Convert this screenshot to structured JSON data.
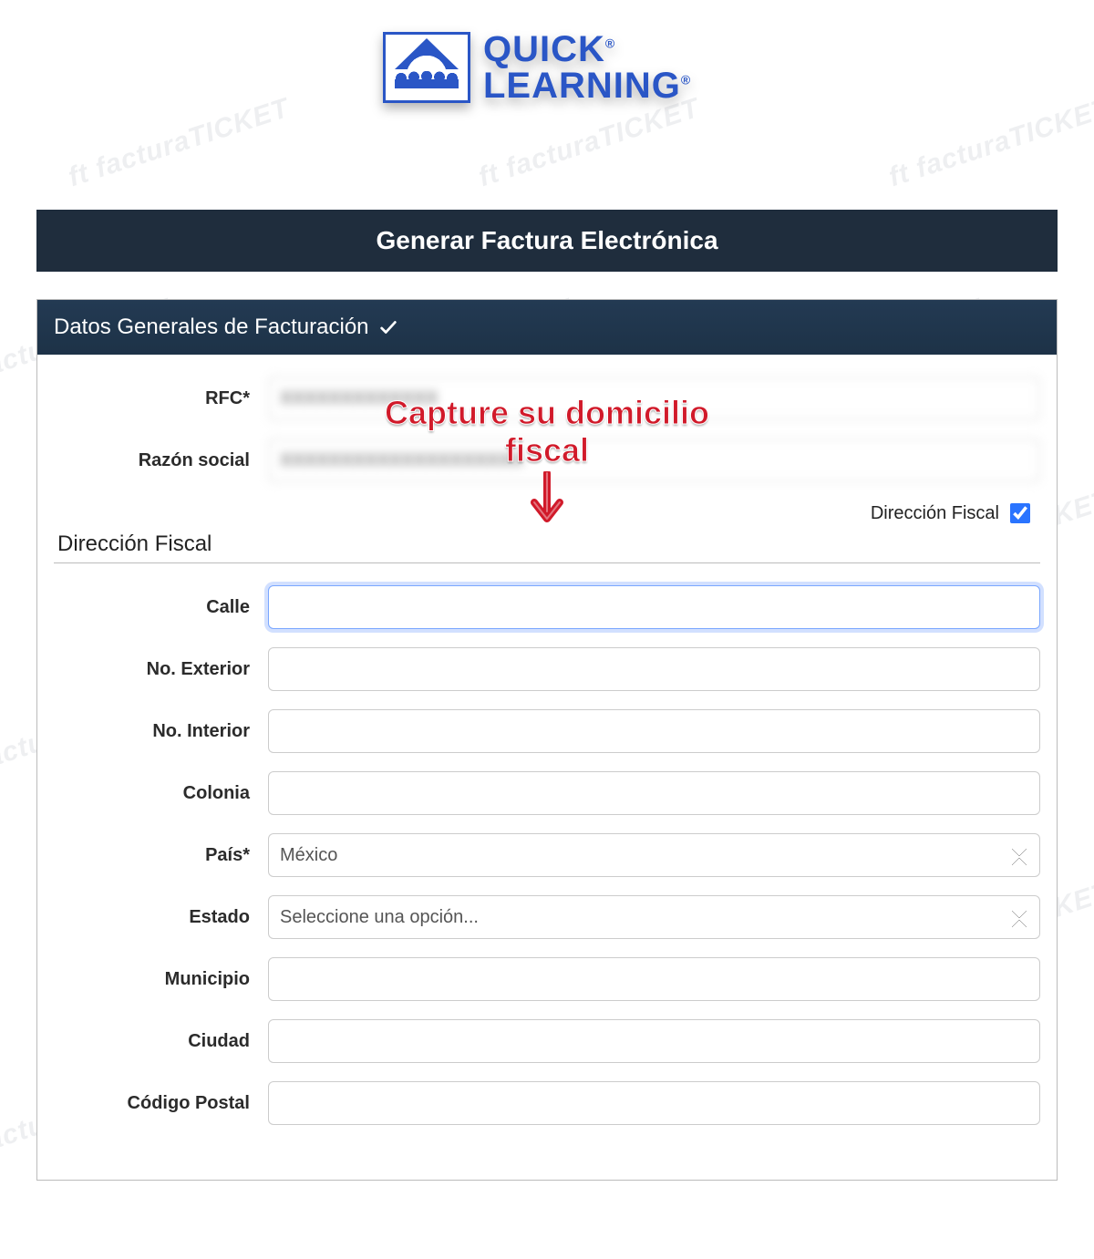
{
  "watermark_text": "ft facturaTICKET",
  "logo": {
    "line1": "QUICK",
    "line2": "LEARNING",
    "registered": "®"
  },
  "title": "Generar Factura Electrónica",
  "panel": {
    "header": "Datos Generales de Facturación"
  },
  "fields": {
    "rfc": {
      "label": "RFC*",
      "value": "XXXXXXXXXXXXX"
    },
    "razon_social": {
      "label": "Razón social",
      "value": "XXXXXXXXXXXXXXXXXXXX"
    },
    "direccion_fiscal_toggle": {
      "label": "Dirección Fiscal",
      "checked": true
    },
    "section_title": "Dirección Fiscal",
    "calle": {
      "label": "Calle",
      "value": ""
    },
    "no_exterior": {
      "label": "No. Exterior",
      "value": ""
    },
    "no_interior": {
      "label": "No. Interior",
      "value": ""
    },
    "colonia": {
      "label": "Colonia",
      "value": ""
    },
    "pais": {
      "label": "País*",
      "value": "México"
    },
    "estado": {
      "label": "Estado",
      "value": "Seleccione una opción..."
    },
    "municipio": {
      "label": "Municipio",
      "value": ""
    },
    "ciudad": {
      "label": "Ciudad",
      "value": ""
    },
    "codigo_postal": {
      "label": "Código Postal",
      "value": ""
    }
  },
  "annotation": {
    "line1": "Capture su domicilio",
    "line2": "fiscal"
  }
}
